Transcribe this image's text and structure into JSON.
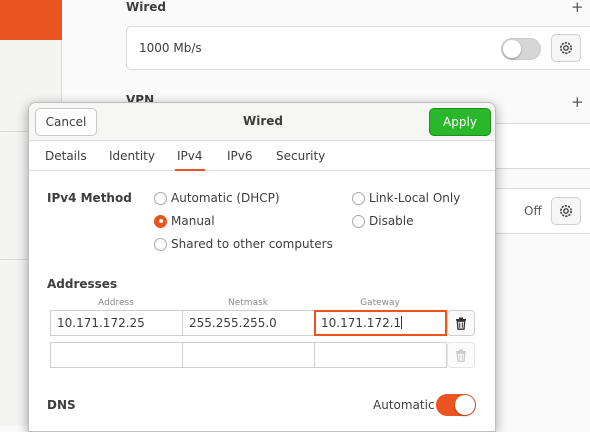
{
  "background": {
    "wired_section": {
      "title": "Wired",
      "plus_icon": "+",
      "connection_speed": "1000 Mb/s",
      "toggle_on": false
    },
    "vpn_section": {
      "title": "VPN",
      "plus_icon": "+",
      "vpn_status": "Off",
      "toggle_on": false
    },
    "accent_color": "#e95420"
  },
  "dialog": {
    "title": "Wired",
    "cancel_label": "Cancel",
    "apply_label": "Apply",
    "apply_color": "#2bb72b",
    "tabs": [
      {
        "label": "Details",
        "active": false
      },
      {
        "label": "Identity",
        "active": false
      },
      {
        "label": "IPv4",
        "active": true
      },
      {
        "label": "IPv6",
        "active": false
      },
      {
        "label": "Security",
        "active": false
      }
    ],
    "ipv4_method": {
      "label": "IPv4 Method",
      "options": [
        {
          "label": "Automatic (DHCP)",
          "checked": false
        },
        {
          "label": "Link-Local Only",
          "checked": false
        },
        {
          "label": "Manual",
          "checked": true
        },
        {
          "label": "Disable",
          "checked": false
        },
        {
          "label": "Shared to other computers",
          "checked": false
        }
      ]
    },
    "addresses": {
      "label": "Addresses",
      "columns": [
        "Address",
        "Netmask",
        "Gateway"
      ],
      "rows": [
        {
          "address": "10.171.172.25",
          "netmask": "255.255.255.0",
          "gateway": "10.171.172.1"
        },
        {
          "address": "",
          "netmask": "",
          "gateway": ""
        }
      ]
    },
    "dns": {
      "label": "DNS",
      "automatic_label": "Automatic",
      "automatic_on": true
    }
  }
}
